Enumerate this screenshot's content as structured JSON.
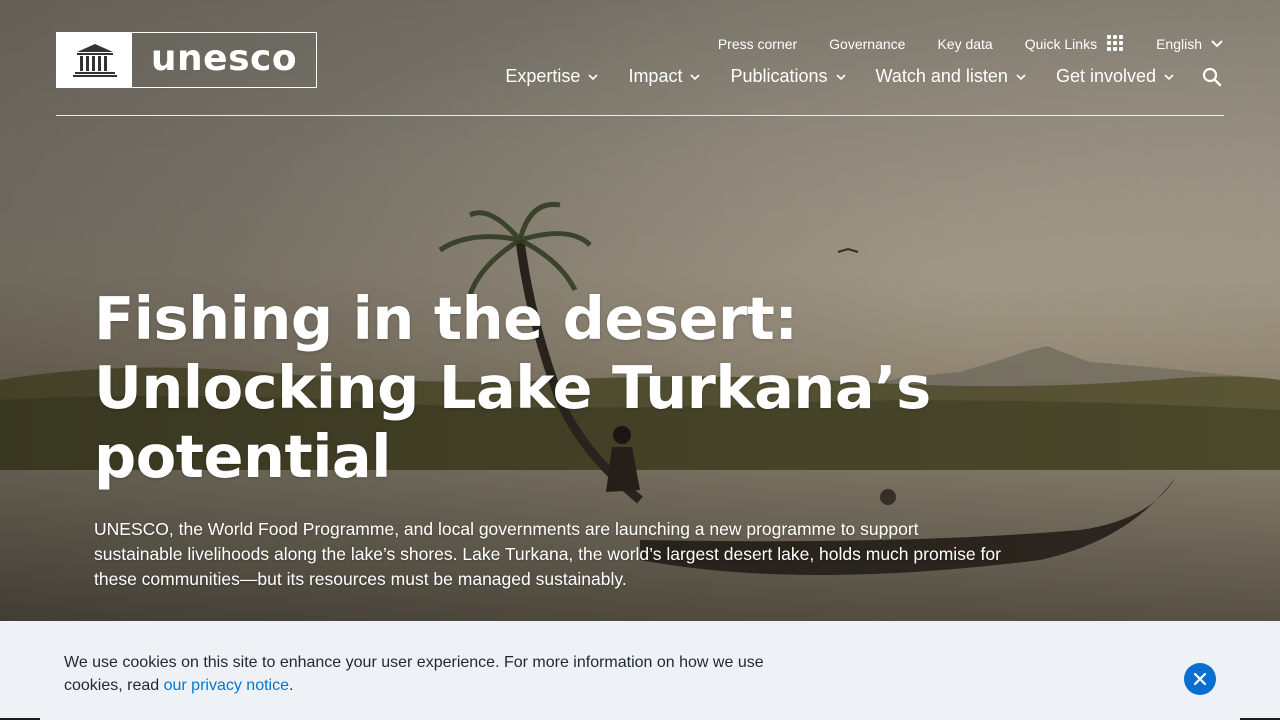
{
  "header": {
    "logo_text": "unesco",
    "utility_links": [
      "Press corner",
      "Governance",
      "Key data"
    ],
    "quick_links_label": "Quick Links",
    "language": "English",
    "main_nav": [
      "Expertise",
      "Impact",
      "Publications",
      "Watch and listen",
      "Get involved"
    ]
  },
  "hero": {
    "title": "Fishing in the desert: Unlocking Lake Turkana’s potential",
    "lede": "UNESCO, the World Food Programme, and local governments are launching a new programme to support sustainable livelihoods along the lake’s shores. Lake Turkana, the world’s largest desert lake, holds much promise for these communities—but its resources must be managed sustainably."
  },
  "cookie_banner": {
    "text_before": "We use cookies on this site to enhance your user experience. For more information on how we use cookies, read ",
    "link_text": "our privacy notice",
    "text_after": "."
  },
  "icons": {
    "quick_links": "grid-dots-icon",
    "language": "chevron-down-icon",
    "search": "search-icon",
    "close": "close-icon"
  },
  "colors": {
    "cookie_bg": "#eef2f6",
    "link": "#0077d4",
    "close_button": "#0a6fd0"
  }
}
